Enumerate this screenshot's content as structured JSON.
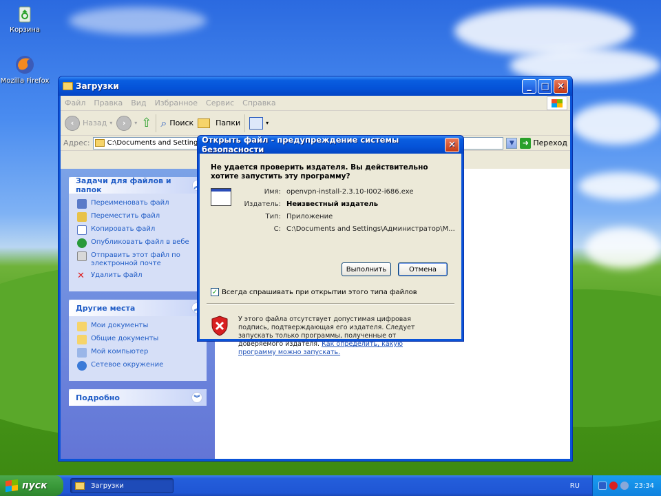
{
  "desktop": {
    "icons": [
      {
        "label": "Корзина",
        "icon": "recycle-bin-icon"
      },
      {
        "label": "Mozilla Firefox",
        "icon": "firefox-icon"
      }
    ]
  },
  "explorer": {
    "title": "Загрузки",
    "menu": [
      "Файл",
      "Правка",
      "Вид",
      "Избранное",
      "Сервис",
      "Справка"
    ],
    "toolbar": {
      "back": "Назад",
      "search": "Поиск",
      "folders": "Папки"
    },
    "address_label": "Адрес:",
    "address_value": "C:\\Documents and Settings\\Ад",
    "go_label": "Переход",
    "file_tasks": {
      "title": "Задачи для файлов и папок",
      "items": [
        "Переименовать файл",
        "Переместить файл",
        "Копировать файл",
        "Опубликовать файл в вебе",
        "Отправить этот файл по электронной почте",
        "Удалить файл"
      ]
    },
    "other_places": {
      "title": "Другие места",
      "items": [
        "Мои документы",
        "Общие документы",
        "Мой компьютер",
        "Сетевое окружение"
      ]
    },
    "details": {
      "title": "Подробно"
    }
  },
  "dialog": {
    "title": "Открыть файл - предупреждение системы безопасности",
    "question": "Не удается проверить издателя.  Вы действительно хотите запустить эту программу?",
    "fields": {
      "name_label": "Имя:",
      "name_value": "openvpn-install-2.3.10-I002-i686.exe",
      "publisher_label": "Издатель:",
      "publisher_value": "Неизвестный издатель",
      "type_label": "Тип:",
      "type_value": "Приложение",
      "from_label": "С:",
      "from_value": "C:\\Documents and Settings\\Администратор\\М..."
    },
    "run_button": "Выполнить",
    "cancel_button": "Отмена",
    "checkbox_label": "Всегда спрашивать при открытии этого типа файлов",
    "checkbox_checked": true,
    "warning_text": "У этого файла отсутствует допустимая цифровая подпись, подтверждающая его издателя.  Следует запускать только программы, полученные от доверяемого издателя.",
    "warning_link": "Как определить, какую программу можно запускать."
  },
  "taskbar": {
    "start_label": "пуск",
    "task": "Загрузки",
    "language": "RU",
    "clock": "23:34"
  }
}
